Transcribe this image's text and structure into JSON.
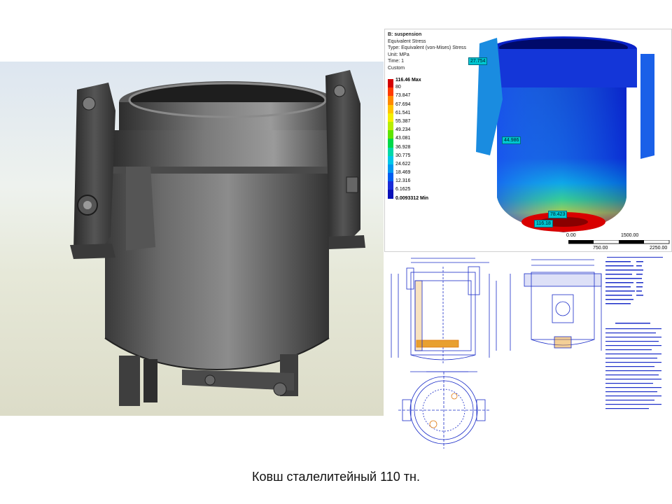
{
  "fea": {
    "title": "B: suspension",
    "line1": "Equivalent Stress",
    "line2": "Type: Equivalent (von-Mises) Stress",
    "line3": "Unit: MPa",
    "line4": "Time: 1",
    "line5": "Custom",
    "legend_max": "116.46 Max",
    "legend_values": [
      "80",
      "73.847",
      "67.694",
      "61.541",
      "55.387",
      "49.234",
      "43.081",
      "36.928",
      "30.775",
      "24.622",
      "18.469",
      "12.316",
      "6.1625"
    ],
    "legend_min": "0.0093312 Min",
    "legend_colors": [
      "#d40000",
      "#ff3b00",
      "#ff8a00",
      "#ffc400",
      "#f3ef00",
      "#b8ee00",
      "#5fe400",
      "#00d84a",
      "#00d8a8",
      "#00c6e8",
      "#0098f0",
      "#005cf0",
      "#1a2cd8",
      "#0a10b8"
    ],
    "tags": [
      "27.754",
      "44.986",
      "78.423",
      "116.18"
    ],
    "scale_labels": [
      "0.00",
      "1500.00",
      "750.00",
      "2250.00"
    ]
  },
  "caption": "Ковш сталелитейный 110 тн."
}
